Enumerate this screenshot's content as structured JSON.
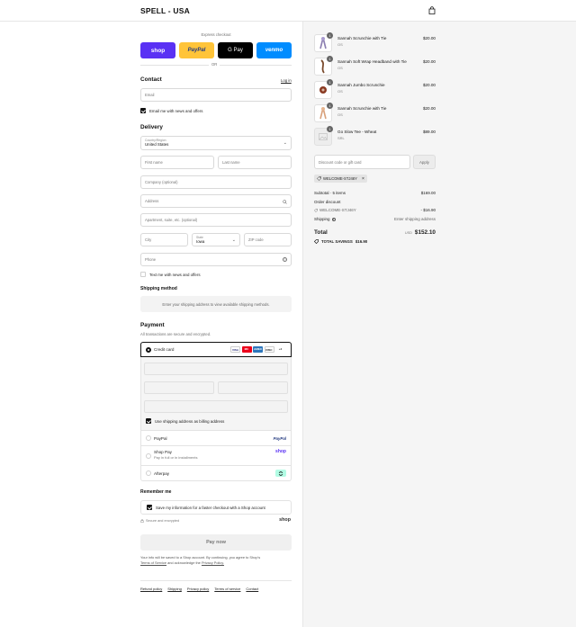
{
  "header": {
    "brand": "SPELL - USA",
    "bag_icon": "shopping-bag-icon"
  },
  "express": {
    "label": "Express checkout",
    "or": "OR",
    "buttons": [
      {
        "label": "shop",
        "color": "#5a31f4"
      },
      {
        "label": "PayPal",
        "color": "#ffc439"
      },
      {
        "label": "G Pay",
        "color": "#000000"
      },
      {
        "label": "venmo",
        "color": "#008cff"
      }
    ]
  },
  "contact": {
    "title": "Contact",
    "login": "Log in",
    "email_placeholder": "Email",
    "newsletter": "Email me with news and offers"
  },
  "delivery": {
    "title": "Delivery",
    "country_label": "Country/Region",
    "country_value": "United States",
    "first_name": "First name",
    "last_name": "Last name",
    "company": "Company (optional)",
    "address": "Address",
    "apartment": "Apartment, suite, etc. (optional)",
    "city": "City",
    "state_label": "State",
    "state_value": "Iowa",
    "zip": "ZIP code",
    "phone": "Phone",
    "sms": "Text me with news and offers"
  },
  "shipping_method": {
    "title": "Shipping method",
    "message": "Enter your shipping address to view available shipping methods."
  },
  "payment": {
    "title": "Payment",
    "subtitle": "All transactions are secure and encrypted.",
    "credit_card": "Credit card",
    "card_brands": [
      "VISA",
      "MC",
      "AMEX",
      "DISC",
      "+4"
    ],
    "billing_same": "Use shipping address as billing address",
    "paypal": "PayPal",
    "paypal_logo": "PayPal",
    "shop_pay": "Shop Pay",
    "shop_pay_sub": "Pay in full or in installments",
    "shop_pay_logo": "shop",
    "afterpay": "Afterpay"
  },
  "remember": {
    "title": "Remember me",
    "save": "Save my information for a faster checkout with a Shop account",
    "secure": "Secure and encrypted",
    "shop_logo": "shop"
  },
  "pay_now": "Pay now",
  "legal": {
    "line1": "Your info will be saved to a Shop account. By continuing, you agree to Shop's",
    "tos": "Terms of Service",
    "and": "and acknowledge the",
    "privacy": "Privacy Policy."
  },
  "footer_links": [
    "Refund policy",
    "Shipping",
    "Privacy policy",
    "Terms of service",
    "Contact"
  ],
  "cart": {
    "items": [
      {
        "name": "Sannah Scrunchie with Tie",
        "variant": "OS",
        "price": "$20.00",
        "qty": "1"
      },
      {
        "name": "Sannah Soft Wrap Headband with Tie",
        "variant": "OS",
        "price": "$20.00",
        "qty": "1"
      },
      {
        "name": "Sannah Jumbo Scrunchie",
        "variant": "OS",
        "price": "$20.00",
        "qty": "1"
      },
      {
        "name": "Sannah Scrunchie with Tie",
        "variant": "OS",
        "price": "$20.00",
        "qty": "1"
      },
      {
        "name": "Go Slow Tee - Wheat",
        "variant": "SRL",
        "price": "$89.00",
        "qty": "1"
      }
    ],
    "discount_placeholder": "Discount code or gift card",
    "apply": "Apply",
    "code_chip": "WELCOME-STJ46Y",
    "subtotal_label": "Subtotal · 5 items",
    "subtotal": "$169.00",
    "order_discount": "Order discount",
    "discount_code": "WELCOME-STJ46Y",
    "discount_amount": "- $16.90",
    "shipping_label": "Shipping",
    "shipping_value": "Enter shipping address",
    "total_label": "Total",
    "currency": "USD",
    "total": "$152.10",
    "savings_label": "TOTAL SAVINGS",
    "savings": "$16.90"
  }
}
